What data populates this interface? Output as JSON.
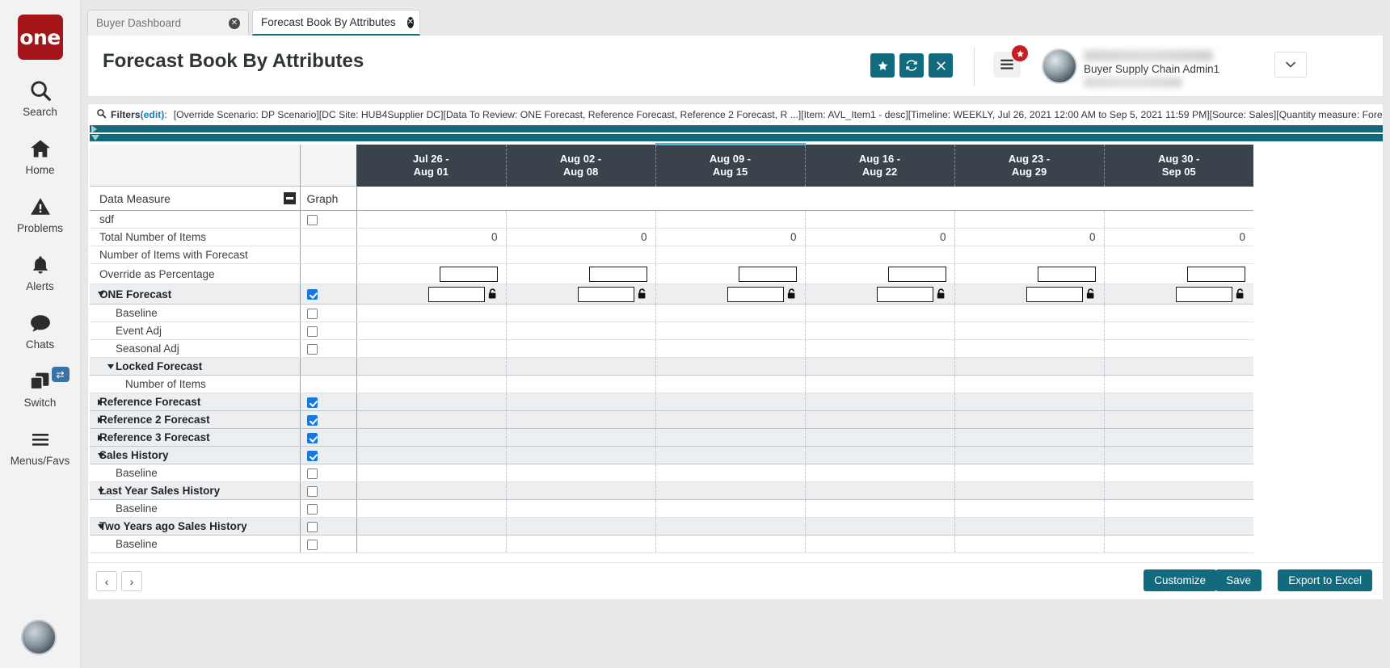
{
  "brand": {
    "logo_text": "one",
    "accent": "#126a7e",
    "logo_bg": "#a5161a"
  },
  "rail": {
    "items": [
      {
        "label": "Search",
        "icon": "search-icon"
      },
      {
        "label": "Home",
        "icon": "home-icon"
      },
      {
        "label": "Problems",
        "icon": "warning-triangle-icon"
      },
      {
        "label": "Alerts",
        "icon": "bell-icon"
      },
      {
        "label": "Chats",
        "icon": "chat-bubble-icon"
      },
      {
        "label": "Switch",
        "icon": "windows-stack-icon",
        "badge": "swap-icon"
      },
      {
        "label": "Menus/Favs",
        "icon": "hamburger-icon"
      }
    ]
  },
  "tabs": [
    {
      "label": "Buyer Dashboard",
      "active": false
    },
    {
      "label": "Forecast Book By Attributes",
      "active": true
    }
  ],
  "header": {
    "title": "Forecast Book By Attributes",
    "buttons": [
      {
        "name": "favorite-button",
        "icon": "star-icon"
      },
      {
        "name": "refresh-button",
        "icon": "refresh-icon"
      },
      {
        "name": "close-button",
        "icon": "close-x-icon"
      }
    ],
    "menu_badge": "star-icon",
    "user_name": "Buyer Supply Chain Admin1",
    "caret": "chevron-down-icon"
  },
  "filters": {
    "icon": "search-icon",
    "label": "Filters",
    "edit_link": "(edit)",
    "colon": ":",
    "text": "[Override Scenario: DP Scenario][DC Site: HUB4Supplier DC][Data To Review: ONE Forecast, Reference Forecast, Reference 2 Forecast, R ...][Item: AVL_Item1 - desc][Timeline: WEEKLY, Jul 26, 2021 12:00 AM to Sep 5, 2021 11:59 PM][Source: Sales][Quantity measure: Forecast UOM]"
  },
  "grid": {
    "col_measure_header": "Data Measure",
    "col_graph_header": "Graph",
    "periods": [
      {
        "line1": "Jul 26 -",
        "line2": "Aug 01",
        "selected": false
      },
      {
        "line1": "Aug 02 -",
        "line2": "Aug 08",
        "selected": false
      },
      {
        "line1": "Aug 09 -",
        "line2": "Aug 15",
        "selected": true
      },
      {
        "line1": "Aug 16 -",
        "line2": "Aug 22",
        "selected": false
      },
      {
        "line1": "Aug 23 -",
        "line2": "Aug 29",
        "selected": false
      },
      {
        "line1": "Aug 30 -",
        "line2": "Sep 05",
        "selected": false
      }
    ],
    "rows": [
      {
        "label": "sdf",
        "indent": 0,
        "group": false,
        "toggle": "",
        "graph": "unchecked",
        "cells": [
          "",
          "",
          "",
          "",
          "",
          ""
        ],
        "cell_type": "text"
      },
      {
        "label": "Total Number of Items",
        "indent": 0,
        "group": false,
        "toggle": "",
        "graph": "none",
        "cells": [
          "0",
          "0",
          "0",
          "0",
          "0",
          "0"
        ],
        "cell_type": "text"
      },
      {
        "label": "Number of Items with Forecast",
        "indent": 0,
        "group": false,
        "toggle": "",
        "graph": "none",
        "cells": [
          "",
          "",
          "",
          "",
          "",
          ""
        ],
        "cell_type": "text"
      },
      {
        "label": "Override as Percentage",
        "indent": 0,
        "group": false,
        "toggle": "",
        "graph": "none",
        "cells": [
          "",
          "",
          "",
          "",
          "",
          ""
        ],
        "cell_type": "input"
      },
      {
        "label": "ONE Forecast",
        "indent": 0,
        "group": true,
        "toggle": "down",
        "graph": "checked",
        "cells": [
          "",
          "",
          "",
          "",
          "",
          ""
        ],
        "cell_type": "input-lock"
      },
      {
        "label": "Baseline",
        "indent": 1,
        "group": false,
        "toggle": "",
        "graph": "unchecked",
        "cells": [
          "",
          "",
          "",
          "",
          "",
          ""
        ],
        "cell_type": "text"
      },
      {
        "label": "Event Adj",
        "indent": 1,
        "group": false,
        "toggle": "",
        "graph": "unchecked",
        "cells": [
          "",
          "",
          "",
          "",
          "",
          ""
        ],
        "cell_type": "text"
      },
      {
        "label": "Seasonal Adj",
        "indent": 1,
        "group": false,
        "toggle": "",
        "graph": "unchecked",
        "cells": [
          "",
          "",
          "",
          "",
          "",
          ""
        ],
        "cell_type": "text"
      },
      {
        "label": "Locked Forecast",
        "indent": 1,
        "group": true,
        "toggle": "down",
        "graph": "none",
        "cells": [
          "",
          "",
          "",
          "",
          "",
          ""
        ],
        "cell_type": "text"
      },
      {
        "label": "Number of Items",
        "indent": 2,
        "group": false,
        "toggle": "",
        "graph": "none",
        "cells": [
          "",
          "",
          "",
          "",
          "",
          ""
        ],
        "cell_type": "text"
      },
      {
        "label": "Reference Forecast",
        "indent": 0,
        "group": true,
        "toggle": "right",
        "graph": "checked",
        "cells": [
          "",
          "",
          "",
          "",
          "",
          ""
        ],
        "cell_type": "text"
      },
      {
        "label": "Reference 2 Forecast",
        "indent": 0,
        "group": true,
        "toggle": "right",
        "graph": "checked",
        "cells": [
          "",
          "",
          "",
          "",
          "",
          ""
        ],
        "cell_type": "text"
      },
      {
        "label": "Reference 3 Forecast",
        "indent": 0,
        "group": true,
        "toggle": "right",
        "graph": "checked",
        "cells": [
          "",
          "",
          "",
          "",
          "",
          ""
        ],
        "cell_type": "text"
      },
      {
        "label": "Sales History",
        "indent": 0,
        "group": true,
        "toggle": "down",
        "graph": "checked",
        "cells": [
          "",
          "",
          "",
          "",
          "",
          ""
        ],
        "cell_type": "text"
      },
      {
        "label": "Baseline",
        "indent": 1,
        "group": false,
        "toggle": "",
        "graph": "unchecked",
        "cells": [
          "",
          "",
          "",
          "",
          "",
          ""
        ],
        "cell_type": "text"
      },
      {
        "label": "Last Year Sales History",
        "indent": 0,
        "group": true,
        "toggle": "down",
        "graph": "unchecked",
        "cells": [
          "",
          "",
          "",
          "",
          "",
          ""
        ],
        "cell_type": "text"
      },
      {
        "label": "Baseline",
        "indent": 1,
        "group": false,
        "toggle": "",
        "graph": "unchecked",
        "cells": [
          "",
          "",
          "",
          "",
          "",
          ""
        ],
        "cell_type": "text"
      },
      {
        "label": "Two Years ago Sales History",
        "indent": 0,
        "group": true,
        "toggle": "down",
        "graph": "unchecked",
        "cells": [
          "",
          "",
          "",
          "",
          "",
          ""
        ],
        "cell_type": "text"
      },
      {
        "label": "Baseline",
        "indent": 1,
        "group": false,
        "toggle": "",
        "graph": "unchecked",
        "cells": [
          "",
          "",
          "",
          "",
          "",
          ""
        ],
        "cell_type": "text"
      }
    ]
  },
  "footer": {
    "prev": "‹",
    "next": "›",
    "customize_label": "Customize",
    "save_label": "Save",
    "export_label": "Export to Excel"
  }
}
